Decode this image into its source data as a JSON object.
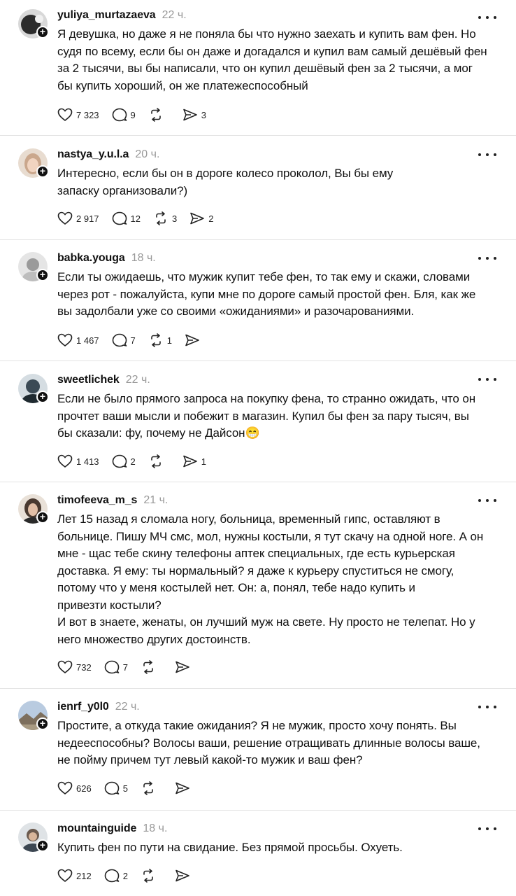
{
  "posts": [
    {
      "username": "yuliya_murtazaeva",
      "time": "22 ч.",
      "text": "Я девушка, но даже я не поняла бы что нужно заехать и купить вам фен. Но\nсудя по всему, если бы он даже и догадался и купил вам самый дешёвый фен\nза 2 тысячи, вы бы написали, что он купил дешёвый фен за 2 тысячи, а мог\nбы купить хороший, он же платежеспособный",
      "likes": "7 323",
      "comments": "9",
      "reposts": "",
      "shares": "3",
      "avatar_color": "#2c2c2c"
    },
    {
      "username": "nastya_y.u.l.a",
      "time": "20 ч.",
      "text": "Интересно, если бы он в дороге колесо проколол, Вы бы ему\nзапаску организовали?)",
      "likes": "2 917",
      "comments": "12",
      "reposts": "3",
      "shares": "2",
      "avatar_color": "#caa78c"
    },
    {
      "username": "babka.youga",
      "time": "18 ч.",
      "text": "Если ты ожидаешь, что мужик купит тебе фен, то так ему и скажи, словами\nчерез рот - пожалуйста, купи мне по дороге самый простой фен. Бля, как же\nвы задолбали уже со своими «ожиданиями» и разочарованиями.",
      "likes": "1 467",
      "comments": "7",
      "reposts": "1",
      "shares": "",
      "avatar_color": "#9a9a9a"
    },
    {
      "username": "sweetlichek",
      "time": "22 ч.",
      "text": "Если не было прямого запроса на покупку фена, то странно ожидать, что он\nпрочтет ваши мысли и побежит в магазин. Купил бы фен за пару тысяч, вы\nбы сказали: фу, почему не Дайсон😁",
      "likes": "1 413",
      "comments": "2",
      "reposts": "",
      "shares": "1",
      "avatar_color": "#3b4a55"
    },
    {
      "username": "timofeeva_m_s",
      "time": "21 ч.",
      "text": "Лет 15 назад я сломала ногу, больница, временный гипс, оставляют в\nбольнице. Пишу МЧ смс, мол, нужны костыли, я тут скачу на одной ноге. А он\nмне - щас тебе скину телефоны аптек специальных, где есть курьерская\nдоставка. Я ему: ты нормальный? я даже к курьеру спуститься не смогу,\nпотому что у меня костылей нет. Он: а, понял, тебе надо купить и\nпривезти костыли?\nИ вот в знаете, женаты, он лучший муж на свете. Ну просто не телепат. Но у\nнего множество других достоинств.",
      "likes": "732",
      "comments": "7",
      "reposts": "",
      "shares": "",
      "avatar_color": "#4a3a30"
    },
    {
      "username": "ienrf_y0l0",
      "time": "22 ч.",
      "text": "Простите, а откуда такие ожидания? Я не мужик, просто хочу понять. Вы\nнедееспособны? Волосы ваши, решение отращивать длинные волосы ваше,\nне пойму причем тут левый какой-то мужик и ваш фен?",
      "likes": "626",
      "comments": "5",
      "reposts": "",
      "shares": "",
      "avatar_color": "#8fa3b8"
    },
    {
      "username": "mountainguide",
      "time": "18 ч.",
      "text": "Купить фен по пути на свидание. Без прямой просьбы. Охуеть.",
      "likes": "212",
      "comments": "2",
      "reposts": "",
      "shares": "",
      "avatar_color": "#6b5a4e"
    }
  ]
}
